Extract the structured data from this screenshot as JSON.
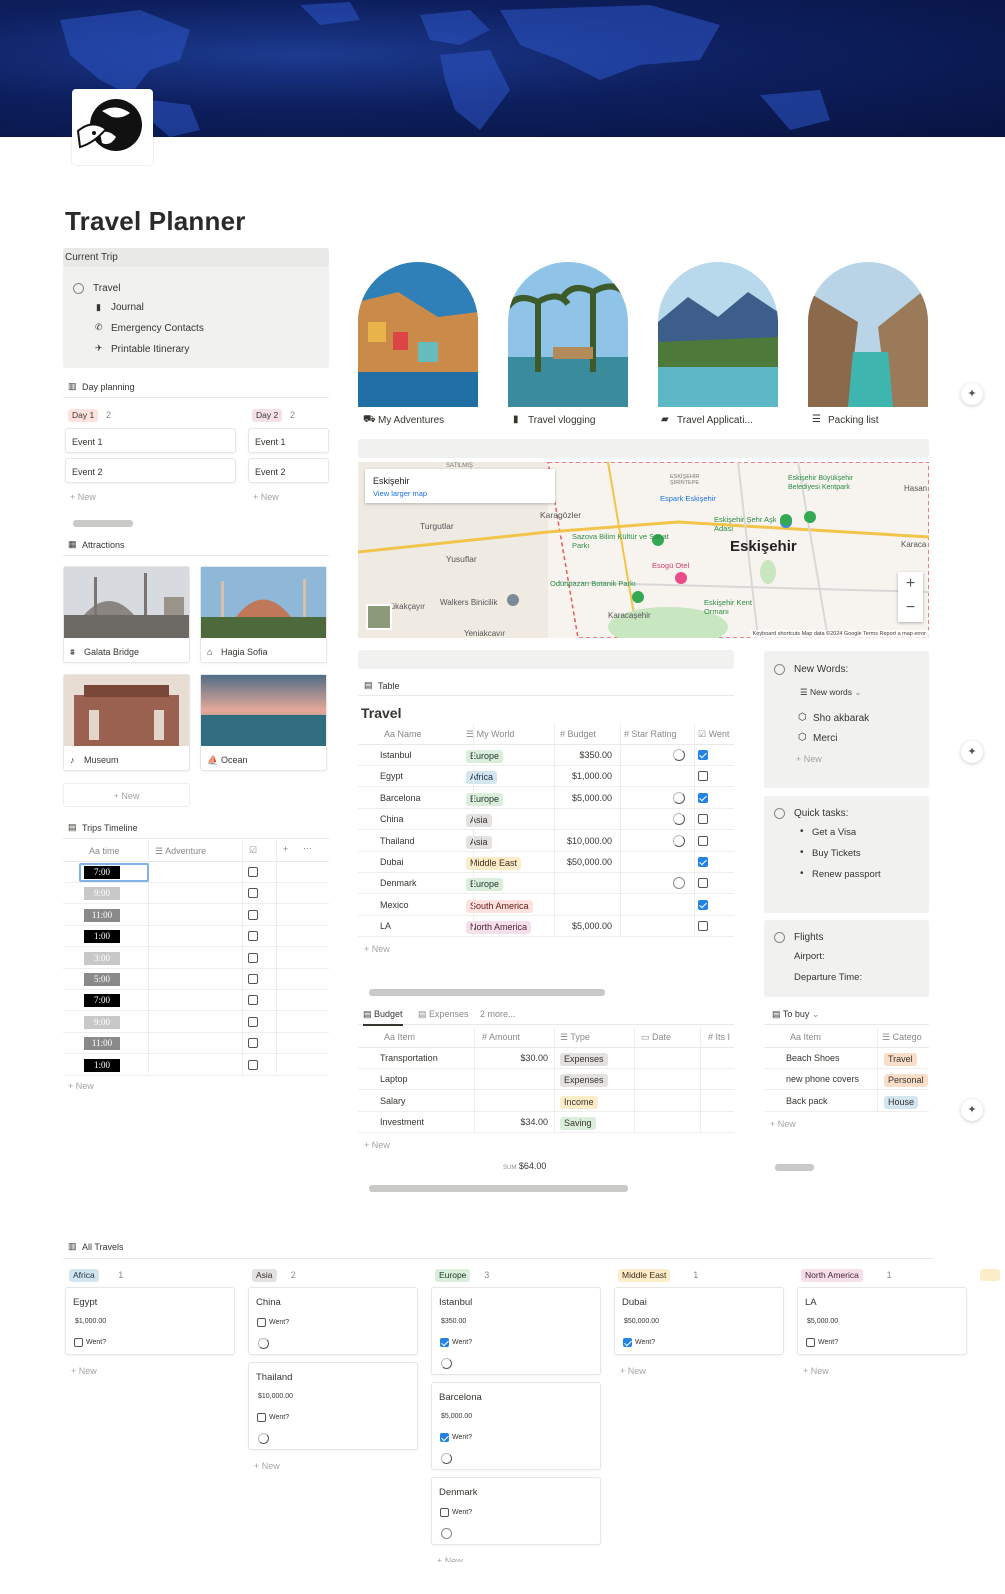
{
  "page": {
    "title": "Travel Planner"
  },
  "current_trip": {
    "heading": "Current Trip",
    "root": "Travel",
    "items": [
      "Journal",
      "Emergency Contacts",
      "Printable Itinerary"
    ]
  },
  "day_planning": {
    "heading": "Day planning",
    "columns": [
      {
        "label": "Day 1",
        "count": "2",
        "events": [
          "Event 1",
          "Event 2"
        ]
      },
      {
        "label": "Day 2",
        "count": "2",
        "events": [
          "Event 1",
          "Event 2"
        ]
      }
    ],
    "new_label": "New"
  },
  "attractions": {
    "heading": "Attractions",
    "items": [
      {
        "name": "Galata Bridge"
      },
      {
        "name": "Hagia Sofia"
      },
      {
        "name": "Museum"
      },
      {
        "name": "Ocean"
      }
    ],
    "new_label": "New"
  },
  "timeline": {
    "heading": "Trips Timeline",
    "col_time": "time",
    "col_adv": "Adventure",
    "times": [
      "7:00",
      "9:00",
      "11:00",
      "1:00",
      "3:00",
      "5:00",
      "7:00",
      "9:00",
      "11:00",
      "1:00"
    ],
    "new_label": "New"
  },
  "gallery": {
    "items": [
      "My Adventures",
      "Travel vlogging",
      "Travel Applicati...",
      "Packing list"
    ]
  },
  "map": {
    "place": "Eskişehir",
    "link": "View larger map",
    "city_label": "Eskişehir",
    "labels": [
      "Turgutlar",
      "Karagözler",
      "Yusuflar",
      "Sazova Bilim Kültür ve Sanat Parkı",
      "Esogü Otel",
      "Odunpazarı Botanik Parkı",
      "Walkers Binicilik",
      "Karacaşehir",
      "Espark Eskişehir",
      "Eskişehir Şehr Aşk Adası",
      "Eskişehir Kent Ormanı",
      "Hasan",
      "Karaca",
      "Eskişehir Büyükşehir Belediyesi Kentpark",
      "rükakçayır",
      "Yeniakcavır",
      "SATILMIŞ",
      "ESKİŞEHİR ŞİRİNTEPE"
    ],
    "footer": "Keyboard shortcuts   Map data ©2024 Google   Terms   Report a map error"
  },
  "travel_table": {
    "view": "Table",
    "title": "Travel",
    "cols": [
      "Name",
      "My World",
      "Budget",
      "Star Rating",
      "Went"
    ],
    "rows": [
      {
        "name": "Istanbul",
        "world": "Europe",
        "budget": "$350.00",
        "ring": "part",
        "went": true
      },
      {
        "name": "Egypt",
        "world": "Africa",
        "budget": "$1,000.00",
        "ring": "",
        "went": false
      },
      {
        "name": "Barcelona",
        "world": "Europe",
        "budget": "$5,000.00",
        "ring": "part",
        "went": true
      },
      {
        "name": "China",
        "world": "Asia",
        "budget": "",
        "ring": "part",
        "went": false
      },
      {
        "name": "Thailand",
        "world": "Asia",
        "budget": "$10,000.00",
        "ring": "part",
        "went": false
      },
      {
        "name": "Dubai",
        "world": "Middle East",
        "budget": "$50,000.00",
        "ring": "",
        "went": true
      },
      {
        "name": "Denmark",
        "world": "Europe",
        "budget": "",
        "ring": "full",
        "went": false
      },
      {
        "name": "Mexico",
        "world": "South America",
        "budget": "",
        "ring": "",
        "went": true
      },
      {
        "name": "LA",
        "world": "North America",
        "budget": "$5,000.00",
        "ring": "",
        "went": false
      }
    ],
    "new_label": "New"
  },
  "world_colors": {
    "Europe": "#dbeddb",
    "Africa": "#d3e5ef",
    "Asia": "#e3e2e0",
    "Middle East": "#fdecc8",
    "South America": "#ffe2dd",
    "North America": "#f5e0e9"
  },
  "world_text": {
    "Europe": "#1c3829",
    "Africa": "#183347",
    "Asia": "#32302c",
    "Middle East": "#402c1b",
    "South America": "#5d1715",
    "North America": "#4c2337"
  },
  "new_words": {
    "heading": "New Words:",
    "view": "New words",
    "items": [
      "Sho akbarak",
      "Merci"
    ],
    "new_label": "New"
  },
  "quick_tasks": {
    "heading": "Quick tasks:",
    "items": [
      "Get a Visa",
      "Buy Tickets",
      "Renew passport"
    ]
  },
  "flights": {
    "heading": "Flights",
    "lines": [
      "Airport:",
      "Departure Time:"
    ]
  },
  "budget": {
    "tabs": [
      "Budget",
      "Expenses",
      "2 more..."
    ],
    "cols": [
      "Item",
      "Amount",
      "Type",
      "Date",
      "Its I"
    ],
    "rows": [
      {
        "item": "Transportation",
        "amount": "$30.00",
        "type": "Expenses"
      },
      {
        "item": "Laptop",
        "amount": "",
        "type": "Expenses"
      },
      {
        "item": "Salary",
        "amount": "",
        "type": "Income"
      },
      {
        "item": "Investment",
        "amount": "$34.00",
        "type": "Saving"
      }
    ],
    "sum_label": "SUM",
    "sum": "$64.00",
    "new_label": "New"
  },
  "type_colors": {
    "Expenses": "#e3e2e0",
    "Income": "#fdecc8",
    "Saving": "#dbeddb"
  },
  "to_buy": {
    "view": "To buy",
    "cols": [
      "Item",
      "Catego"
    ],
    "rows": [
      {
        "item": "Beach Shoes",
        "cat": "Travel",
        "color": "#fadec9"
      },
      {
        "item": "new phone covers",
        "cat": "Personal",
        "color": "#fadec9"
      },
      {
        "item": "Back pack",
        "cat": "House",
        "color": "#d3e5ef"
      }
    ],
    "new_label": "New"
  },
  "all_travels": {
    "heading": "All Travels",
    "went_label": "Went?",
    "new_label": "New",
    "groups": [
      {
        "label": "Africa",
        "count": "1",
        "cards": [
          {
            "name": "Egypt",
            "budget": "$1,000.00",
            "went": false,
            "ring": ""
          }
        ]
      },
      {
        "label": "Asia",
        "count": "2",
        "cards": [
          {
            "name": "China",
            "budget": "",
            "went": false,
            "ring": "part"
          },
          {
            "name": "Thailand",
            "budget": "$10,000.00",
            "went": false,
            "ring": "part"
          }
        ]
      },
      {
        "label": "Europe",
        "count": "3",
        "cards": [
          {
            "name": "Istanbul",
            "budget": "$350.00",
            "went": true,
            "ring": "part"
          },
          {
            "name": "Barcelona",
            "budget": "$5,000.00",
            "went": true,
            "ring": "part"
          },
          {
            "name": "Denmark",
            "budget": "",
            "went": false,
            "ring": "full"
          }
        ]
      },
      {
        "label": "Middle East",
        "count": "1",
        "cards": [
          {
            "name": "Dubai",
            "budget": "$50,000.00",
            "went": true,
            "ring": ""
          }
        ]
      },
      {
        "label": "North America",
        "count": "1",
        "cards": [
          {
            "name": "LA",
            "budget": "$5,000.00",
            "went": false,
            "ring": ""
          }
        ]
      }
    ]
  }
}
